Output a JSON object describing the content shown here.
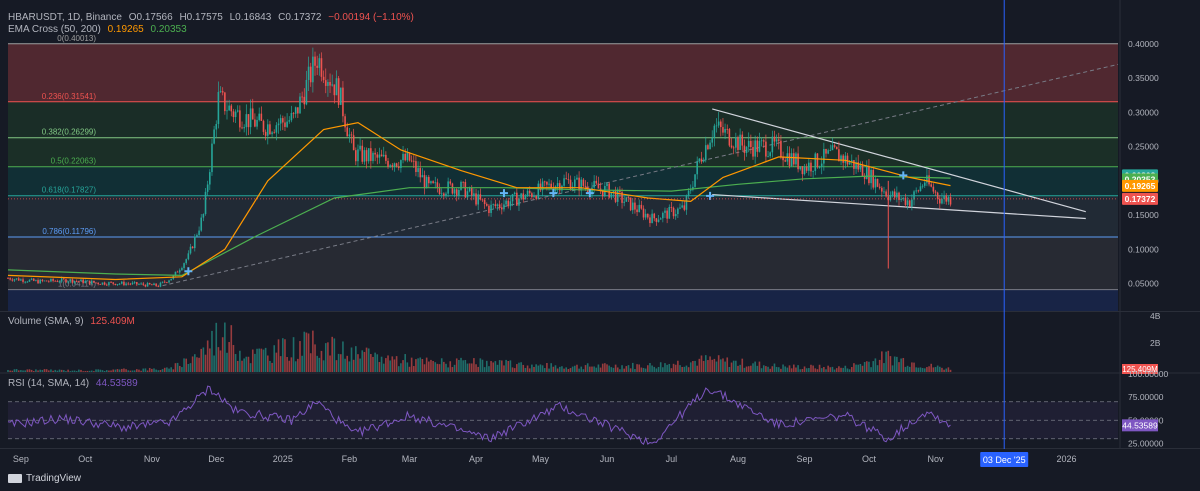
{
  "header": {
    "symbol": "HBARUSDT, 1D, Binance",
    "open": "O0.17566",
    "high": "H0.17575",
    "low": "L0.16843",
    "close": "C0.17372",
    "change": "−0.00194 (−1.10%)",
    "ema_label": "EMA Cross (50, 200)",
    "ema50_value": "0.19265",
    "ema200_value": "0.20353"
  },
  "volume_panel": {
    "label": "Volume (SMA, 9)",
    "value": "125.409M",
    "scale_4b": "4B",
    "scale_2b": "2B",
    "price_tag": "125.409M"
  },
  "rsi_panel": {
    "label": "RSI (14, SMA, 14)",
    "value": "44.53589",
    "scale_top": "100.00000",
    "scale_75": "75.00000",
    "scale_50": "50.00000",
    "scale_25": "25.00000"
  },
  "branding": {
    "logo_text": "TradingView"
  },
  "crosshair": {
    "date_tag": "03 Dec '25"
  },
  "colors": {
    "background": "#161a25",
    "candle_up": "#26a69a",
    "candle_down": "#ef5350",
    "ema50": "#ff9800",
    "ema200": "#4caf50",
    "rsi": "#7e57c2",
    "crosshair": "#2962ff"
  },
  "chart_data": {
    "type": "candlestick",
    "symbol": "HBARUSDT",
    "timeframe": "1D",
    "exchange": "Binance",
    "ylim": [
      0.01,
      0.41
    ],
    "y_ticks": [
      "0.40000",
      "0.35000",
      "0.30000",
      "0.25000",
      "0.20000",
      "0.15000",
      "0.10000",
      "0.05000"
    ],
    "x_tick_labels": [
      "Sep",
      "Oct",
      "Nov",
      "Dec",
      "2025",
      "Feb",
      "Mar",
      "Apr",
      "May",
      "Jun",
      "Jul",
      "Aug",
      "Sep",
      "Oct",
      "Nov",
      "Dec",
      "2026"
    ],
    "price_tags": [
      {
        "value": 0.20808,
        "text": "0.20808",
        "color": "#26a69a"
      },
      {
        "value": 0.20353,
        "text": "0.20353",
        "color": "#4caf50"
      },
      {
        "value": 0.19265,
        "text": "0.19265",
        "color": "#ff9800"
      },
      {
        "value": 0.17372,
        "text": "0.17372",
        "color": "#ef5350"
      }
    ],
    "fib_levels": [
      {
        "label": "0(0.40013)",
        "value": 0.40013
      },
      {
        "label": "0.236(0.31541)",
        "value": 0.31541
      },
      {
        "label": "0.382(0.26299)",
        "value": 0.26299
      },
      {
        "label": "0.5(0.22063)",
        "value": 0.22063
      },
      {
        "label": "0.618(0.17827)",
        "value": 0.17827
      },
      {
        "label": "0.786(0.11796)",
        "value": 0.11796
      },
      {
        "label": "1(0.04114)",
        "value": 0.04114
      }
    ],
    "price_series": [
      [
        "2024-08-26",
        0.058
      ],
      [
        "2024-09-09",
        0.053
      ],
      [
        "2024-09-23",
        0.055
      ],
      [
        "2024-10-07",
        0.051
      ],
      [
        "2024-10-21",
        0.05
      ],
      [
        "2024-11-04",
        0.047
      ],
      [
        "2024-11-11",
        0.06
      ],
      [
        "2024-11-18",
        0.09
      ],
      [
        "2024-11-25",
        0.15
      ],
      [
        "2024-12-02",
        0.32
      ],
      [
        "2024-12-09",
        0.3
      ],
      [
        "2024-12-23",
        0.28
      ],
      [
        "2025-01-06",
        0.29
      ],
      [
        "2025-01-17",
        0.38
      ],
      [
        "2025-01-27",
        0.33
      ],
      [
        "2025-02-03",
        0.24
      ],
      [
        "2025-02-17",
        0.23
      ],
      [
        "2025-03-01",
        0.23
      ],
      [
        "2025-03-10",
        0.19
      ],
      [
        "2025-03-25",
        0.19
      ],
      [
        "2025-04-07",
        0.16
      ],
      [
        "2025-04-21",
        0.175
      ],
      [
        "2025-05-12",
        0.2
      ],
      [
        "2025-06-02",
        0.185
      ],
      [
        "2025-06-22",
        0.145
      ],
      [
        "2025-07-07",
        0.16
      ],
      [
        "2025-07-14",
        0.23
      ],
      [
        "2025-07-21",
        0.28
      ],
      [
        "2025-08-04",
        0.25
      ],
      [
        "2025-08-18",
        0.25
      ],
      [
        "2025-09-01",
        0.22
      ],
      [
        "2025-09-15",
        0.24
      ],
      [
        "2025-09-29",
        0.215
      ],
      [
        "2025-10-10",
        0.18
      ],
      [
        "2025-10-20",
        0.17
      ],
      [
        "2025-10-27",
        0.2
      ],
      [
        "2025-11-03",
        0.175
      ],
      [
        "2025-11-08",
        0.174
      ]
    ],
    "ema50_series": [
      [
        "2024-08-26",
        0.062
      ],
      [
        "2024-10-15",
        0.056
      ],
      [
        "2024-11-15",
        0.06
      ],
      [
        "2024-12-05",
        0.1
      ],
      [
        "2024-12-25",
        0.2
      ],
      [
        "2025-01-20",
        0.275
      ],
      [
        "2025-02-05",
        0.285
      ],
      [
        "2025-02-25",
        0.245
      ],
      [
        "2025-03-25",
        0.215
      ],
      [
        "2025-04-20",
        0.19
      ],
      [
        "2025-05-20",
        0.19
      ],
      [
        "2025-06-20",
        0.175
      ],
      [
        "2025-07-10",
        0.17
      ],
      [
        "2025-07-25",
        0.205
      ],
      [
        "2025-08-20",
        0.235
      ],
      [
        "2025-09-20",
        0.23
      ],
      [
        "2025-10-20",
        0.205
      ],
      [
        "2025-11-08",
        0.193
      ]
    ],
    "ema200_series": [
      [
        "2024-08-26",
        0.07
      ],
      [
        "2024-10-15",
        0.064
      ],
      [
        "2024-11-15",
        0.062
      ],
      [
        "2024-12-20",
        0.12
      ],
      [
        "2025-01-25",
        0.175
      ],
      [
        "2025-03-01",
        0.19
      ],
      [
        "2025-04-15",
        0.19
      ],
      [
        "2025-05-20",
        0.187
      ],
      [
        "2025-07-01",
        0.185
      ],
      [
        "2025-08-01",
        0.195
      ],
      [
        "2025-09-01",
        0.203
      ],
      [
        "2025-10-01",
        0.207
      ],
      [
        "2025-11-08",
        0.204
      ]
    ],
    "volume": {
      "unit": "B",
      "ylim": [
        0,
        4
      ],
      "series": [
        [
          "2024-08-26",
          0.2
        ],
        [
          "2024-10-01",
          0.15
        ],
        [
          "2024-11-10",
          0.3
        ],
        [
          "2024-11-25",
          2.0
        ],
        [
          "2024-12-03",
          3.8
        ],
        [
          "2024-12-15",
          1.5
        ],
        [
          "2025-01-17",
          2.6
        ],
        [
          "2025-02-03",
          1.6
        ],
        [
          "2025-03-10",
          0.9
        ],
        [
          "2025-04-07",
          0.8
        ],
        [
          "2025-05-10",
          0.5
        ],
        [
          "2025-06-22",
          0.6
        ],
        [
          "2025-07-18",
          1.1
        ],
        [
          "2025-08-20",
          0.5
        ],
        [
          "2025-09-20",
          0.4
        ],
        [
          "2025-10-10",
          1.4
        ],
        [
          "2025-10-27",
          0.6
        ],
        [
          "2025-11-08",
          0.3
        ]
      ]
    },
    "rsi": {
      "ylim": [
        20,
        100
      ],
      "levels": [
        70,
        50,
        30
      ],
      "series": [
        [
          "2024-08-26",
          45
        ],
        [
          "2024-09-20",
          52
        ],
        [
          "2024-10-20",
          42
        ],
        [
          "2024-11-10",
          48
        ],
        [
          "2024-11-28",
          85
        ],
        [
          "2024-12-10",
          60
        ],
        [
          "2025-01-05",
          50
        ],
        [
          "2025-01-17",
          70
        ],
        [
          "2025-02-03",
          35
        ],
        [
          "2025-03-01",
          55
        ],
        [
          "2025-04-07",
          30
        ],
        [
          "2025-05-10",
          65
        ],
        [
          "2025-06-22",
          25
        ],
        [
          "2025-07-18",
          85
        ],
        [
          "2025-08-20",
          45
        ],
        [
          "2025-09-20",
          55
        ],
        [
          "2025-10-10",
          30
        ],
        [
          "2025-10-28",
          60
        ],
        [
          "2025-11-08",
          44.5
        ]
      ]
    }
  }
}
